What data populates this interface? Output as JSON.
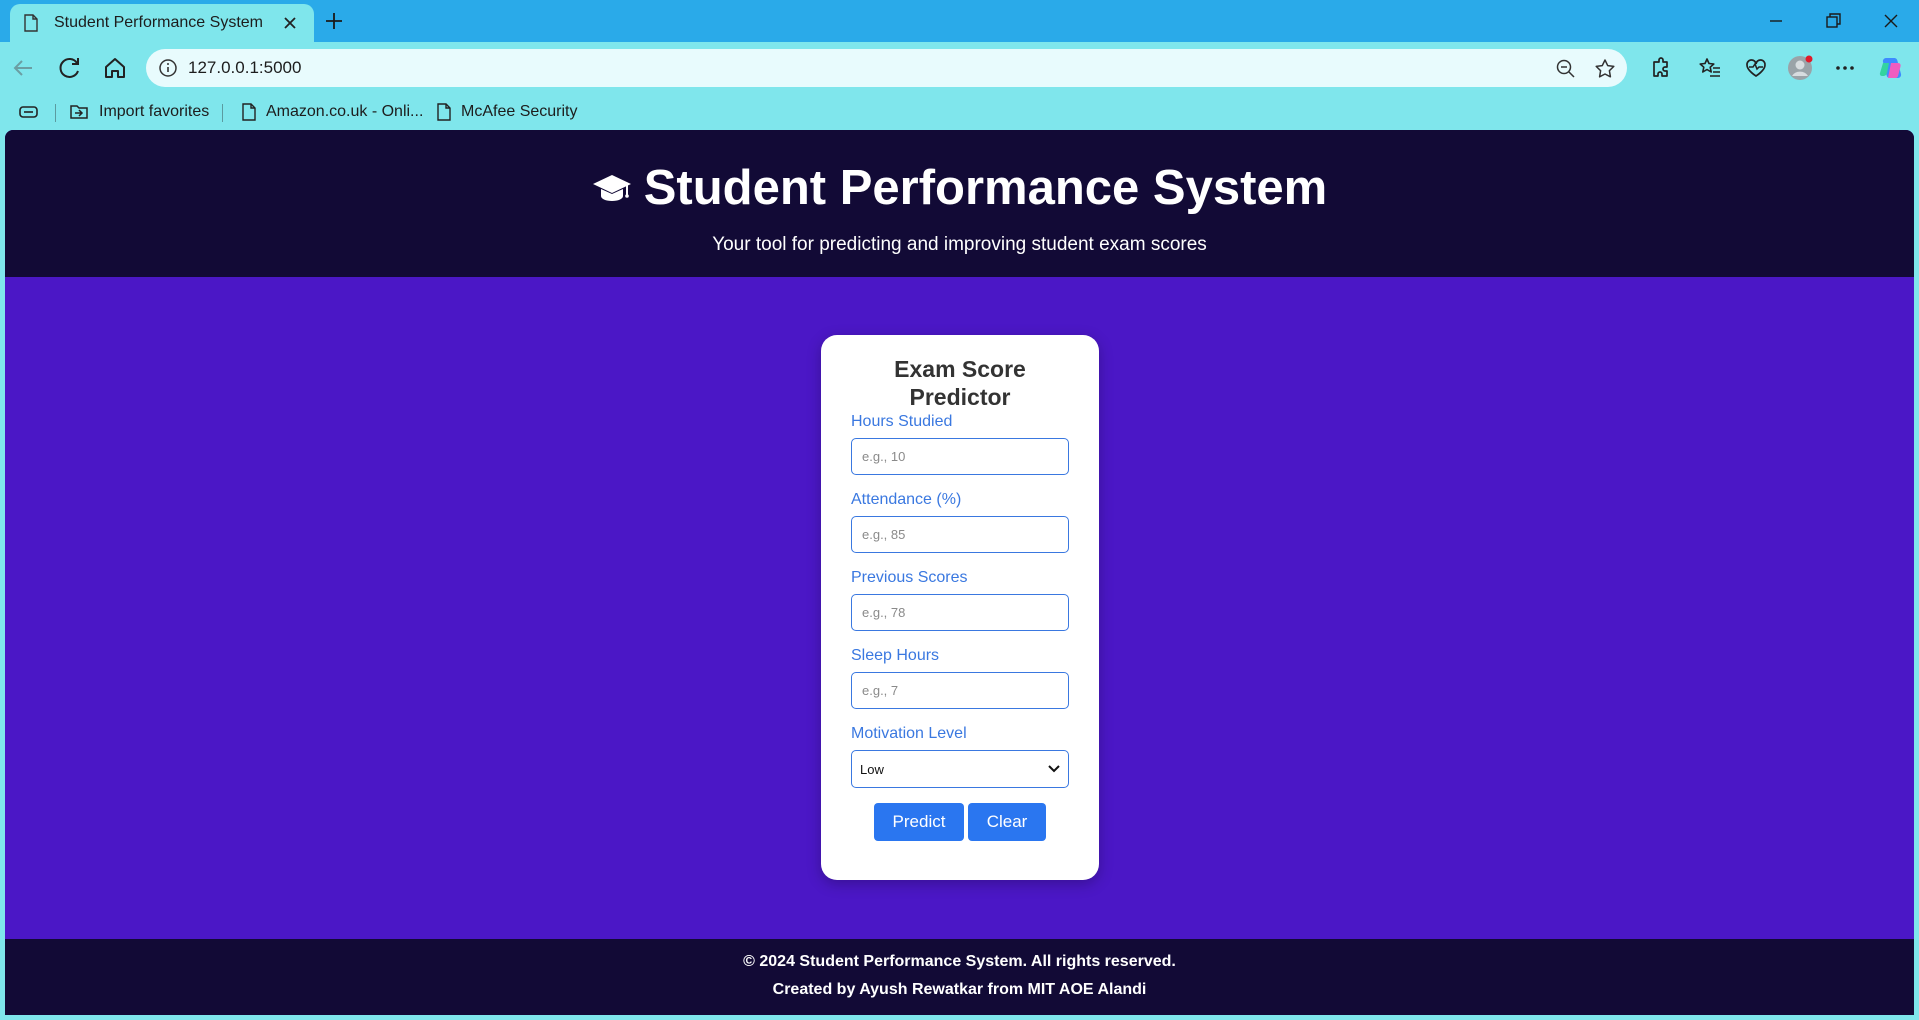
{
  "browser": {
    "tab_title": "Student Performance System",
    "url": "127.0.0.1:5000",
    "bookmarks": [
      {
        "label": "Import favorites",
        "icon": "import-favorites-icon"
      },
      {
        "label": "Amazon.co.uk - Onli...",
        "icon": "page-icon"
      },
      {
        "label": "McAfee Security",
        "icon": "page-icon"
      }
    ],
    "colors": {
      "titlebar": "#2aaae9",
      "toolbar": "#7fe6ec"
    }
  },
  "header": {
    "title": "Student Performance System",
    "subtitle": "Your tool for predicting and improving student exam scores",
    "icon": "graduation-cap-icon"
  },
  "form": {
    "title": "Exam Score Predictor",
    "fields": [
      {
        "label": "Hours Studied",
        "placeholder": "e.g., 10"
      },
      {
        "label": "Attendance (%)",
        "placeholder": "e.g., 85"
      },
      {
        "label": "Previous Scores",
        "placeholder": "e.g., 78"
      },
      {
        "label": "Sleep Hours",
        "placeholder": "e.g., 7"
      }
    ],
    "motivation": {
      "label": "Motivation Level",
      "selected": "Low"
    },
    "predict_label": "Predict",
    "clear_label": "Clear"
  },
  "footer": {
    "line1": "© 2024 Student Performance System. All rights reserved.",
    "line2": "Created by Ayush Rewatkar from MIT AOE Alandi"
  },
  "colors": {
    "page_bg": "#4b17c6",
    "header_bg": "#120a36",
    "accent": "#2a76f0",
    "label": "#3a78e0"
  }
}
